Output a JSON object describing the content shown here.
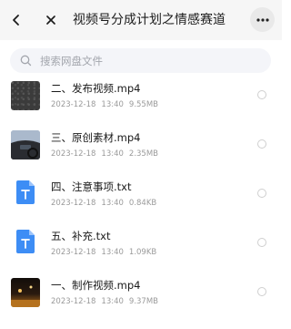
{
  "header": {
    "title": "视频号分成计划之情感赛道"
  },
  "search": {
    "placeholder": "搜索网盘文件"
  },
  "files": [
    {
      "name": "二、发布视频.mp4",
      "date": "2023-12-18",
      "time": "13:40",
      "size": "9.55MB",
      "type": "video",
      "icon": "video-thumbnail"
    },
    {
      "name": "三、原创素材.mp4",
      "date": "2023-12-18",
      "time": "13:40",
      "size": "2.35MB",
      "type": "video",
      "icon": "video-thumbnail"
    },
    {
      "name": "四、注意事项.txt",
      "date": "2023-12-18",
      "time": "13:40",
      "size": "0.84KB",
      "type": "txt",
      "icon": "txt-file-icon"
    },
    {
      "name": "五、补充.txt",
      "date": "2023-12-18",
      "time": "13:40",
      "size": "1.09KB",
      "type": "txt",
      "icon": "txt-file-icon"
    },
    {
      "name": "一、制作视频.mp4",
      "date": "2023-12-18",
      "time": "13:40",
      "size": "9.37MB",
      "type": "video",
      "icon": "video-thumbnail"
    }
  ],
  "colors": {
    "header_bg": "#f6f6f6",
    "search_bg": "#f4f5f9",
    "txt_icon": "#3d8df5",
    "meta_text": "#9a9a9a"
  }
}
